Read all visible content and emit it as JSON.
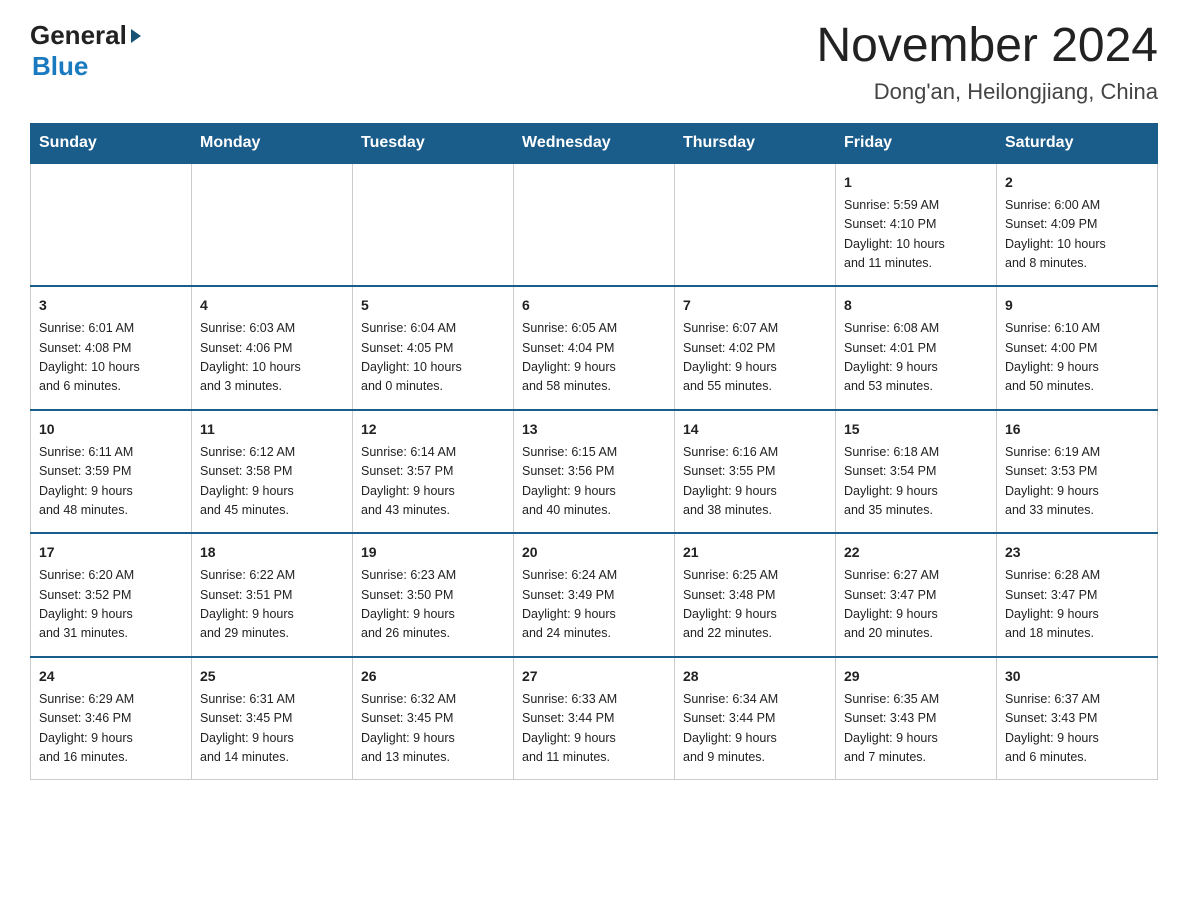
{
  "logo": {
    "text_general": "General",
    "text_blue": "Blue"
  },
  "header": {
    "title": "November 2024",
    "subtitle": "Dong'an, Heilongjiang, China"
  },
  "days_of_week": [
    "Sunday",
    "Monday",
    "Tuesday",
    "Wednesday",
    "Thursday",
    "Friday",
    "Saturday"
  ],
  "weeks": [
    [
      {
        "num": "",
        "info": ""
      },
      {
        "num": "",
        "info": ""
      },
      {
        "num": "",
        "info": ""
      },
      {
        "num": "",
        "info": ""
      },
      {
        "num": "",
        "info": ""
      },
      {
        "num": "1",
        "info": "Sunrise: 5:59 AM\nSunset: 4:10 PM\nDaylight: 10 hours\nand 11 minutes."
      },
      {
        "num": "2",
        "info": "Sunrise: 6:00 AM\nSunset: 4:09 PM\nDaylight: 10 hours\nand 8 minutes."
      }
    ],
    [
      {
        "num": "3",
        "info": "Sunrise: 6:01 AM\nSunset: 4:08 PM\nDaylight: 10 hours\nand 6 minutes."
      },
      {
        "num": "4",
        "info": "Sunrise: 6:03 AM\nSunset: 4:06 PM\nDaylight: 10 hours\nand 3 minutes."
      },
      {
        "num": "5",
        "info": "Sunrise: 6:04 AM\nSunset: 4:05 PM\nDaylight: 10 hours\nand 0 minutes."
      },
      {
        "num": "6",
        "info": "Sunrise: 6:05 AM\nSunset: 4:04 PM\nDaylight: 9 hours\nand 58 minutes."
      },
      {
        "num": "7",
        "info": "Sunrise: 6:07 AM\nSunset: 4:02 PM\nDaylight: 9 hours\nand 55 minutes."
      },
      {
        "num": "8",
        "info": "Sunrise: 6:08 AM\nSunset: 4:01 PM\nDaylight: 9 hours\nand 53 minutes."
      },
      {
        "num": "9",
        "info": "Sunrise: 6:10 AM\nSunset: 4:00 PM\nDaylight: 9 hours\nand 50 minutes."
      }
    ],
    [
      {
        "num": "10",
        "info": "Sunrise: 6:11 AM\nSunset: 3:59 PM\nDaylight: 9 hours\nand 48 minutes."
      },
      {
        "num": "11",
        "info": "Sunrise: 6:12 AM\nSunset: 3:58 PM\nDaylight: 9 hours\nand 45 minutes."
      },
      {
        "num": "12",
        "info": "Sunrise: 6:14 AM\nSunset: 3:57 PM\nDaylight: 9 hours\nand 43 minutes."
      },
      {
        "num": "13",
        "info": "Sunrise: 6:15 AM\nSunset: 3:56 PM\nDaylight: 9 hours\nand 40 minutes."
      },
      {
        "num": "14",
        "info": "Sunrise: 6:16 AM\nSunset: 3:55 PM\nDaylight: 9 hours\nand 38 minutes."
      },
      {
        "num": "15",
        "info": "Sunrise: 6:18 AM\nSunset: 3:54 PM\nDaylight: 9 hours\nand 35 minutes."
      },
      {
        "num": "16",
        "info": "Sunrise: 6:19 AM\nSunset: 3:53 PM\nDaylight: 9 hours\nand 33 minutes."
      }
    ],
    [
      {
        "num": "17",
        "info": "Sunrise: 6:20 AM\nSunset: 3:52 PM\nDaylight: 9 hours\nand 31 minutes."
      },
      {
        "num": "18",
        "info": "Sunrise: 6:22 AM\nSunset: 3:51 PM\nDaylight: 9 hours\nand 29 minutes."
      },
      {
        "num": "19",
        "info": "Sunrise: 6:23 AM\nSunset: 3:50 PM\nDaylight: 9 hours\nand 26 minutes."
      },
      {
        "num": "20",
        "info": "Sunrise: 6:24 AM\nSunset: 3:49 PM\nDaylight: 9 hours\nand 24 minutes."
      },
      {
        "num": "21",
        "info": "Sunrise: 6:25 AM\nSunset: 3:48 PM\nDaylight: 9 hours\nand 22 minutes."
      },
      {
        "num": "22",
        "info": "Sunrise: 6:27 AM\nSunset: 3:47 PM\nDaylight: 9 hours\nand 20 minutes."
      },
      {
        "num": "23",
        "info": "Sunrise: 6:28 AM\nSunset: 3:47 PM\nDaylight: 9 hours\nand 18 minutes."
      }
    ],
    [
      {
        "num": "24",
        "info": "Sunrise: 6:29 AM\nSunset: 3:46 PM\nDaylight: 9 hours\nand 16 minutes."
      },
      {
        "num": "25",
        "info": "Sunrise: 6:31 AM\nSunset: 3:45 PM\nDaylight: 9 hours\nand 14 minutes."
      },
      {
        "num": "26",
        "info": "Sunrise: 6:32 AM\nSunset: 3:45 PM\nDaylight: 9 hours\nand 13 minutes."
      },
      {
        "num": "27",
        "info": "Sunrise: 6:33 AM\nSunset: 3:44 PM\nDaylight: 9 hours\nand 11 minutes."
      },
      {
        "num": "28",
        "info": "Sunrise: 6:34 AM\nSunset: 3:44 PM\nDaylight: 9 hours\nand 9 minutes."
      },
      {
        "num": "29",
        "info": "Sunrise: 6:35 AM\nSunset: 3:43 PM\nDaylight: 9 hours\nand 7 minutes."
      },
      {
        "num": "30",
        "info": "Sunrise: 6:37 AM\nSunset: 3:43 PM\nDaylight: 9 hours\nand 6 minutes."
      }
    ]
  ]
}
